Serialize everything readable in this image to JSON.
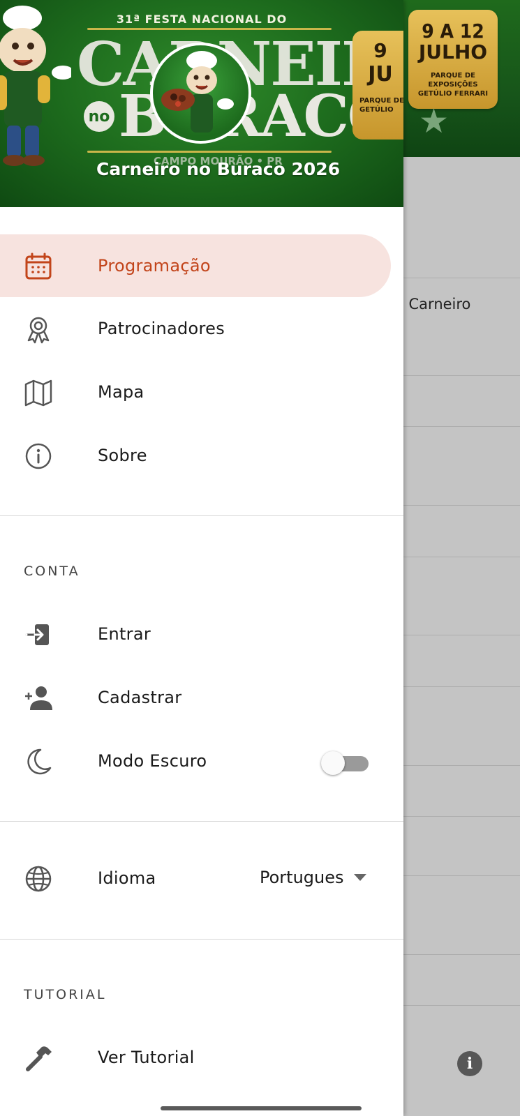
{
  "app": {
    "title": "Carneiro no Buraco 2026"
  },
  "header_banner": {
    "edition": "31ª FESTA NACIONAL DO",
    "name_line1": "CARNEIRO",
    "name_no": "no",
    "name_line2": "BURACO",
    "city": "CAMPO MOURÃO • PR",
    "date_day": "9 A 12",
    "date_month": "JULHO",
    "venue": "PARQUE DE EXPOSIÇÕES GETÚLIO FERRARI",
    "date_partial_day": "9",
    "date_partial_month": "JU",
    "venue_partial": "PARQUE DE GETÚLIO"
  },
  "menu": {
    "items": [
      {
        "label": "Programação",
        "icon": "calendar-icon",
        "active": true
      },
      {
        "label": "Patrocinadores",
        "icon": "award-ribbon-icon",
        "active": false
      },
      {
        "label": "Mapa",
        "icon": "map-icon",
        "active": false
      },
      {
        "label": "Sobre",
        "icon": "info-icon",
        "active": false
      }
    ]
  },
  "account": {
    "section_label": "CONTA",
    "items": [
      {
        "label": "Entrar",
        "icon": "login-icon"
      },
      {
        "label": "Cadastrar",
        "icon": "add-user-icon"
      },
      {
        "label": "Modo Escuro",
        "icon": "moon-icon"
      }
    ],
    "dark_mode_enabled": false
  },
  "language": {
    "label": "Idioma",
    "icon": "globe-icon",
    "selected": "Portugues"
  },
  "tutorial": {
    "section_label": "TUTORIAL",
    "item_label": "Ver Tutorial",
    "icon": "hammer-icon"
  },
  "background": {
    "visible_title_fragment": "o Carneiro",
    "info_icon": "info-icon"
  },
  "colors": {
    "accent": "#c2441a",
    "active_bg": "#f7e3df",
    "banner_green": "#1d6b1d",
    "gold": "#d9ac3e"
  }
}
